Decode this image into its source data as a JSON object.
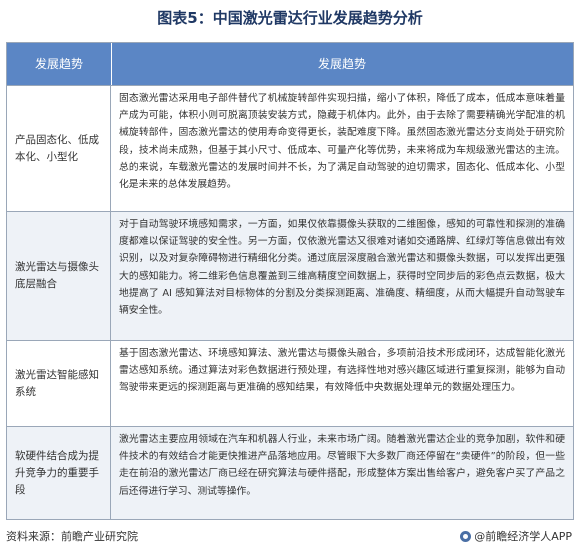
{
  "title": "图表5：中国激光雷达行业发展趋势分析",
  "table": {
    "headers": [
      "发展趋势",
      "发展趋势"
    ],
    "rows": [
      {
        "trend": "产品固态化、低成本化、小型化",
        "detail": "固态激光雷达采用电子部件替代了机械旋转部件实现扫描，缩小了体积，降低了成本，低成本意味着量产成为可能，体积小则可脱离顶装安装方式，隐藏于机体内。此外，由于去除了需要精确光学配准的机械旋转部件，固态激光雷达的使用寿命变得更长，装配难度下降。虽然固态激光雷达分支尚处于研究阶段，技术尚未成熟，但基于其小尺寸、低成本、可量产化等优势，未来将成为车规级激光雷达的主流。总的来说，车载激光雷达的发展时间并不长，为了满足自动驾驶的迫切需求，固态化、低成本化、小型化是未来的总体发展趋势。"
      },
      {
        "trend": "激光雷达与摄像头底层融合",
        "detail": "对于自动驾驶环境感知需求，一方面，如果仅依靠摄像头获取的二维图像，感知的可靠性和探测的准确度都难以保证驾驶的安全性。另一方面，仅依激光雷达又很难对诸如交通路牌、红绿灯等信息做出有效识别，以及对复杂障碍物进行精细化分类。通过底层深度融合激光雷达和摄像头数据，可以发挥出更强大的感知能力。将二维彩色信息覆盖到三维高精度空间数据上，获得时空同步后的彩色点云数据，极大地提高了 AI 感知算法对目标物体的分割及分类探测距离、准确度、精细度，从而大幅提升自动驾驶车辆安全性。"
      },
      {
        "trend": "激光雷达智能感知系统",
        "detail": "基于固态激光雷达、环境感知算法、激光雷达与摄像头融合，多项前沿技术形成闭环，达成智能化激光雷达感知系统。通过算法对彩色数据进行预处理，有选择性地对感兴趣区域进行重复探测，能够为自动驾驶带来更远的探测距离与更准确的感知结果，有效降低中央数据处理单元的数据处理压力。"
      },
      {
        "trend": "软硬件结合成为提升竞争力的重要手段",
        "detail": "激光雷达主要应用领域在汽车和机器人行业，未来市场广阔。随着激光雷达企业的竞争加剧，软件和硬件技术的有效结合才能更快推进产品落地应用。尽管眼下大多数厂商还停留在“卖硬件”的阶段，但一些走在前沿的激光雷达厂商已经在研究算法与硬件搭配，形成整体方案出售给客户，避免客户买了产品之后还得进行学习、测试等操作。"
      }
    ]
  },
  "footer": {
    "source": "资料来源：前瞻产业研究院",
    "brand": "@前瞻经济学人APP",
    "logo_icon": "qianzhan-logo-icon"
  },
  "colors": {
    "header_bg": "#5b86c5",
    "title": "#1f3864",
    "alt_row": "#eef2f7"
  }
}
